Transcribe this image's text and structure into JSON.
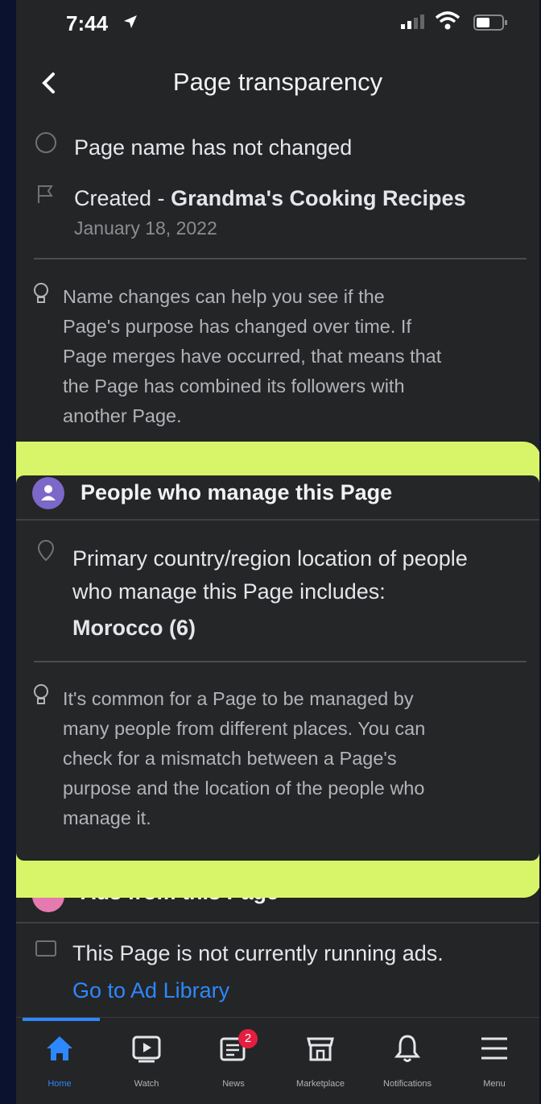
{
  "status_bar": {
    "time": "7:44"
  },
  "header": {
    "title": "Page transparency"
  },
  "history": {
    "name_row": "Page name has not changed",
    "created_prefix": "Created - ",
    "created_name": "Grandma's Cooking Recipes",
    "created_date": "January 18, 2022",
    "tip_lines": [
      "Name changes can help you see if the",
      "Page's purpose has changed over time. If",
      "Page merges have occurred, that means that",
      "the Page has combined its followers with",
      "another Page."
    ]
  },
  "managers": {
    "title": "People who manage this Page",
    "location_lines": [
      "Primary country/region location of people",
      "who manage this Page includes:"
    ],
    "country": "Morocco (6)",
    "tip_lines": [
      "It's common for a Page to be managed by",
      "many people from different places. You can",
      "check for a mismatch between a Page's",
      "purpose and the location of the people who",
      "manage it."
    ]
  },
  "ads": {
    "title": "Ads from this Page",
    "status": "This Page is not currently running ads.",
    "link": "Go to Ad Library"
  },
  "nav": {
    "active": "Home",
    "accent": "#2d88ff",
    "items": [
      {
        "label": "Home",
        "icon": "home-icon"
      },
      {
        "label": "Watch",
        "icon": "watch-icon"
      },
      {
        "label": "News",
        "icon": "news-icon",
        "badge": "2"
      },
      {
        "label": "Marketplace",
        "icon": "marketplace-icon"
      },
      {
        "label": "Notifications",
        "icon": "bell-icon"
      },
      {
        "label": "Menu",
        "icon": "menu-icon"
      }
    ]
  },
  "colors": {
    "highlight": "#d8f56a",
    "managers_icon": "#7b68c8",
    "ads_icon": "#e57ab0",
    "link": "#2d88ff"
  }
}
